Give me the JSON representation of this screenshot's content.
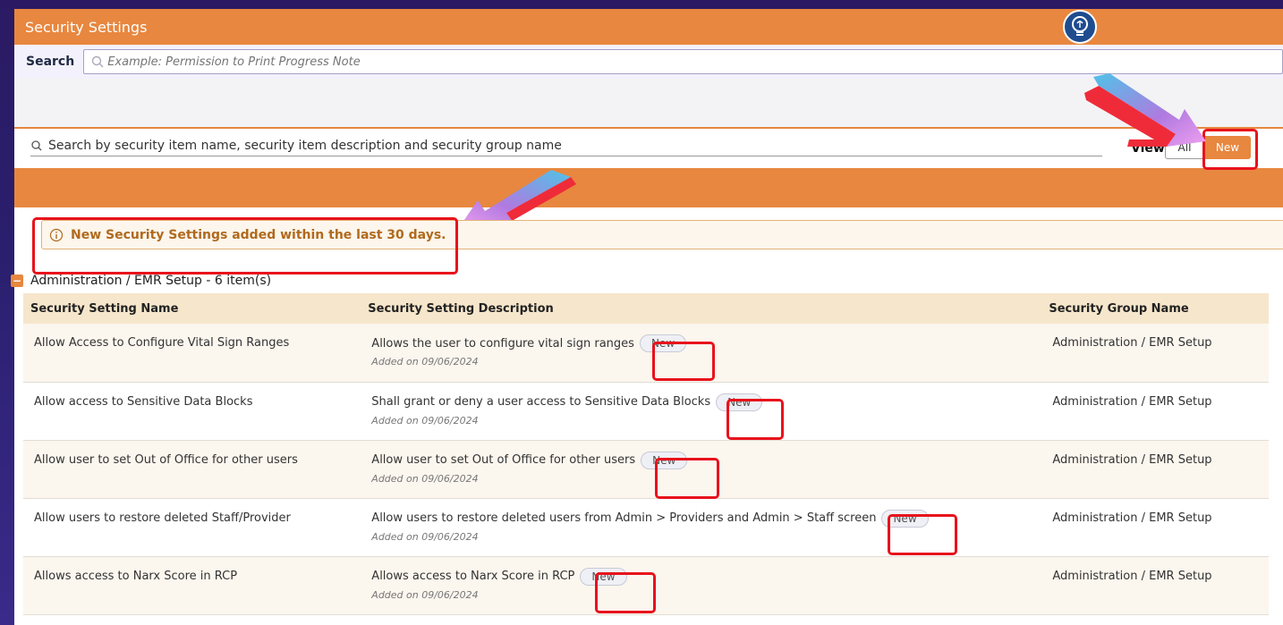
{
  "window": {
    "title": "Security Settings"
  },
  "search": {
    "label": "Search",
    "placeholder": "Example: Permission to Print Progress Note"
  },
  "filter": {
    "placeholder": "Search by security item name, security item description and security group name",
    "view_label": "View",
    "view_options": [
      "All",
      "New"
    ],
    "active_view": "New"
  },
  "notice": {
    "text": "New Security Settings added within the last 30 days."
  },
  "group": {
    "title": "Administration / EMR Setup - 6 item(s)"
  },
  "table": {
    "columns": [
      "Security Setting Name",
      "Security Setting Description",
      "Security Group Name"
    ],
    "rows": [
      {
        "name": "Allow Access to Configure Vital Sign Ranges",
        "description": "Allows the user to configure vital sign ranges",
        "badge": "New",
        "added": "Added on 09/06/2024",
        "group": "Administration / EMR Setup"
      },
      {
        "name": "Allow access to Sensitive Data Blocks",
        "description": "Shall grant or deny a user access to Sensitive Data Blocks",
        "badge": "New",
        "added": "Added on 09/06/2024",
        "group": "Administration / EMR Setup"
      },
      {
        "name": "Allow user to set Out of Office for other users",
        "description": "Allow user to set Out of Office for other users",
        "badge": "New",
        "added": "Added on 09/06/2024",
        "group": "Administration / EMR Setup"
      },
      {
        "name": "Allow users to restore deleted Staff/Provider",
        "description": "Allow users to restore deleted users from Admin > Providers and Admin > Staff screen",
        "badge": "New",
        "added": "Added on 09/06/2024",
        "group": "Administration / EMR Setup"
      },
      {
        "name": "Allows access to Narx Score in RCP",
        "description": "Allows access to Narx Score in RCP",
        "badge": "New",
        "added": "Added on 09/06/2024",
        "group": "Administration / EMR Setup"
      }
    ]
  },
  "colors": {
    "accent": "#e8873f",
    "highlight": "#e8121c",
    "header_bg": "#f6e6cb"
  },
  "icons": [
    "lightbulb-icon",
    "search-icon",
    "info-icon",
    "collapse-icon"
  ]
}
